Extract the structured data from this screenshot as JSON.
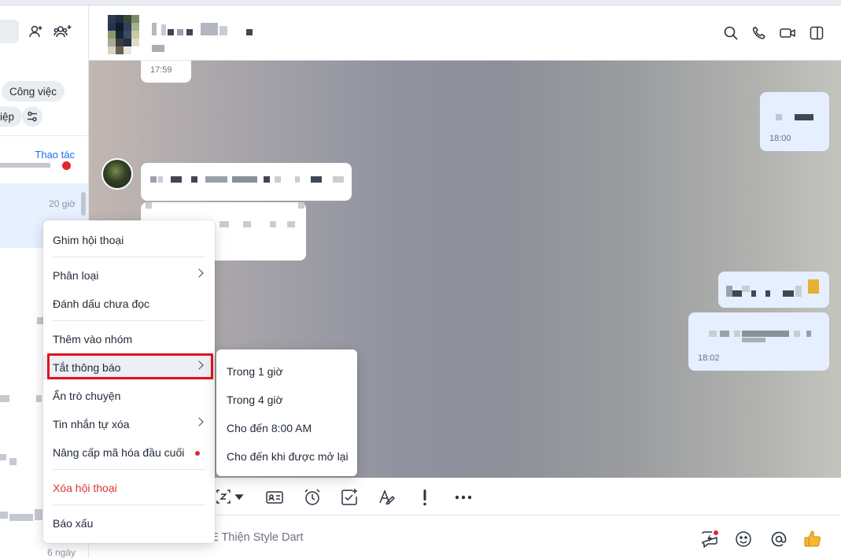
{
  "sidebar": {
    "filter_chip_work": "Công việc",
    "filter_chip_partial": "iệp",
    "actions_link": "Thao tác",
    "conversations": [
      {
        "time": "20 giờ"
      },
      {
        "time": "6 ngày"
      }
    ]
  },
  "chat": {
    "messages": [
      {
        "time": "17:59"
      },
      {
        "time": "18:00"
      },
      {
        "time": "18:02"
      }
    ]
  },
  "composer": {
    "placeholder": "E Thiện Style Dart"
  },
  "context_menu": {
    "items": [
      {
        "label": "Ghim hội thoại"
      },
      {
        "label": "Phân loại",
        "has_submenu": true
      },
      {
        "label": "Đánh dấu chưa đọc"
      },
      {
        "label": "Thêm vào nhóm"
      },
      {
        "label": "Tắt thông báo",
        "has_submenu": true,
        "highlighted": true
      },
      {
        "label": "Ẩn trò chuyện"
      },
      {
        "label": "Tin nhắn tự xóa",
        "has_submenu": true
      },
      {
        "label": "Nâng cấp mã hóa đầu cuối",
        "badge": "red-dot"
      },
      {
        "label": "Xóa hội thoại",
        "style": "danger"
      },
      {
        "label": "Báo xấu"
      }
    ]
  },
  "mute_submenu": {
    "items": [
      {
        "label": "Trong 1 giờ"
      },
      {
        "label": "Trong 4 giờ"
      },
      {
        "label": "Cho đến 8:00 AM"
      },
      {
        "label": "Cho đến khi được mở lại"
      }
    ]
  },
  "colors": {
    "accent": "#1a6ff2",
    "danger": "#db342e",
    "highlight_box": "#e0141b",
    "my_bubble": "#e5efff"
  }
}
